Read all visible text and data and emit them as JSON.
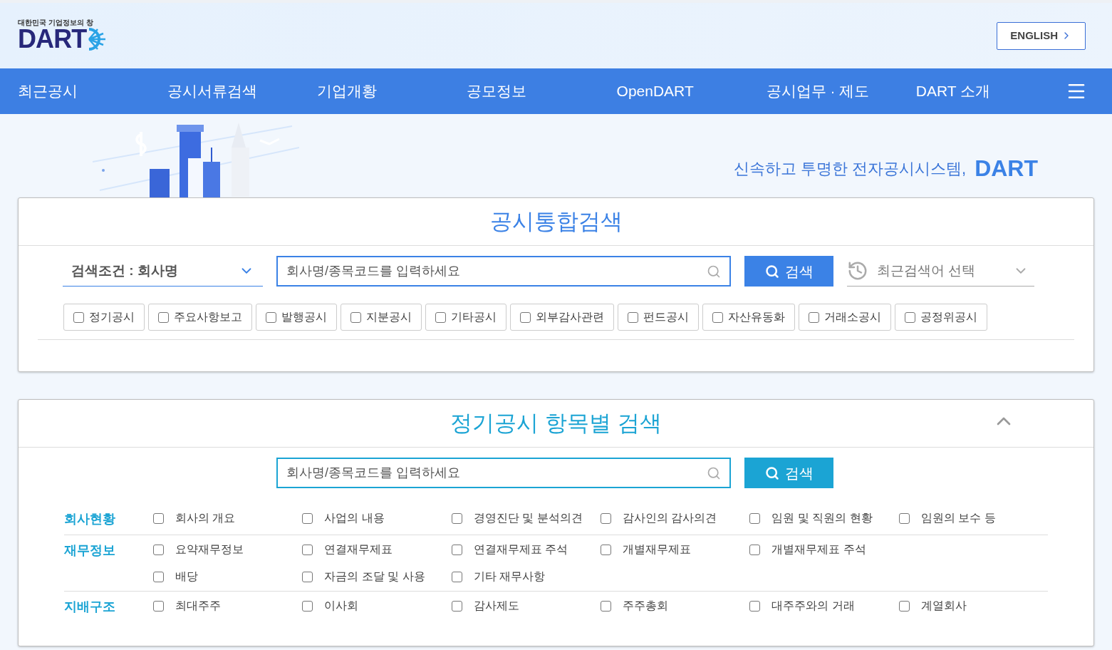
{
  "header": {
    "logo": {
      "tagline": "대한민국 기업정보의 창",
      "wordmark": "DART"
    },
    "language_button": "ENGLISH"
  },
  "nav": {
    "items": [
      "최근공시",
      "공시서류검색",
      "기업개황",
      "공모정보",
      "OpenDART",
      "공시업무 · 제도",
      "DART 소개"
    ]
  },
  "banner": {
    "slogan": "신속하고 투명한 전자공시시스템,",
    "brand": "DART"
  },
  "integrated_search": {
    "title": "공시통합검색",
    "condition": "검색조건 : 회사명",
    "search": {
      "placeholder": "회사명/종목코드를 입력하세요"
    },
    "search_button": "검색",
    "recent": "최근검색어 선택",
    "filters": [
      {
        "label": "정기공시",
        "checked": false
      },
      {
        "label": "주요사항보고",
        "checked": false
      },
      {
        "label": "발행공시",
        "checked": false
      },
      {
        "label": "지분공시",
        "checked": false
      },
      {
        "label": "기타공시",
        "checked": false
      },
      {
        "label": "외부감사관련",
        "checked": false
      },
      {
        "label": "펀드공시",
        "checked": false
      },
      {
        "label": "자산유동화",
        "checked": false
      },
      {
        "label": "거래소공시",
        "checked": false
      },
      {
        "label": "공정위공시",
        "checked": false
      }
    ]
  },
  "item_search": {
    "title": "정기공시 항목별 검색",
    "expanded": true,
    "search": {
      "placeholder": "회사명/종목코드를 입력하세요"
    },
    "search_button": "검색",
    "groups": [
      {
        "label": "회사현황",
        "rows": [
          [
            {
              "label": "회사의 개요",
              "checked": false
            },
            {
              "label": "사업의 내용",
              "checked": false
            },
            {
              "label": "경영진단 및 분석의견",
              "checked": false
            },
            {
              "label": "감사인의 감사의견",
              "checked": false
            },
            {
              "label": "임원 및 직원의 현황",
              "checked": false
            },
            {
              "label": "임원의 보수 등",
              "checked": false
            }
          ]
        ]
      },
      {
        "label": "재무정보",
        "rows": [
          [
            {
              "label": "요약재무정보",
              "checked": false
            },
            {
              "label": "연결재무제표",
              "checked": false
            },
            {
              "label": "연결재무제표 주석",
              "checked": false
            },
            {
              "label": "개별재무제표",
              "checked": false
            },
            {
              "label": "개별재무제표 주석",
              "checked": false
            }
          ],
          [
            {
              "label": "배당",
              "checked": false
            },
            {
              "label": "자금의 조달 및 사용",
              "checked": false
            },
            {
              "label": "기타 재무사항",
              "checked": false
            }
          ]
        ]
      },
      {
        "label": "지배구조",
        "rows": [
          [
            {
              "label": "최대주주",
              "checked": false
            },
            {
              "label": "이사회",
              "checked": false
            },
            {
              "label": "감사제도",
              "checked": false
            },
            {
              "label": "주주총회",
              "checked": false
            },
            {
              "label": "대주주와의 거래",
              "checked": false
            },
            {
              "label": "계열회사",
              "checked": false
            }
          ]
        ]
      }
    ]
  }
}
